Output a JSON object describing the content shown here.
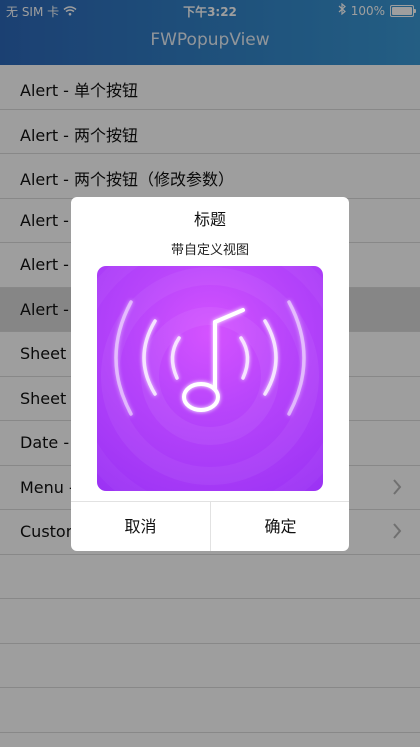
{
  "status_bar": {
    "carrier": "无 SIM 卡",
    "time": "下午3:22",
    "battery": "100%",
    "wifi_icon": "wifi-icon",
    "bluetooth_icon": "bluetooth-icon"
  },
  "nav": {
    "title": "FWPopupView"
  },
  "list": {
    "items": [
      {
        "label": "Alert - 单个按钮",
        "chevron": false
      },
      {
        "label": "Alert - 两个按钮",
        "chevron": false
      },
      {
        "label": "Alert - 两个按钮（修改参数）",
        "chevron": false
      },
      {
        "label": "Alert -",
        "chevron": false
      },
      {
        "label": "Alert -",
        "chevron": false
      },
      {
        "label": "Alert -",
        "chevron": false,
        "selected": true
      },
      {
        "label": "Sheet",
        "chevron": false
      },
      {
        "label": "Sheet",
        "chevron": false
      },
      {
        "label": "Date -",
        "chevron": false
      },
      {
        "label": "Menu -",
        "chevron": true
      },
      {
        "label": "Custom",
        "chevron": true
      }
    ]
  },
  "popup": {
    "title": "标题",
    "subtitle": "带自定义视图",
    "image_icon": "music-note-icon",
    "cancel_label": "取消",
    "confirm_label": "确定"
  },
  "colors": {
    "nav_gradient_start": "#2d68b9",
    "nav_gradient_end": "#3a98d4",
    "art_purple": "#b845fb",
    "overlay": "rgba(0,0,0,0.38)"
  }
}
